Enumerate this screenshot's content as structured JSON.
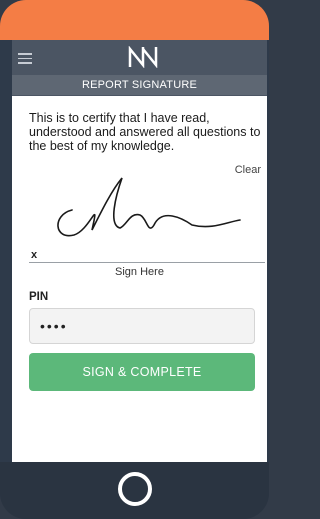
{
  "colors": {
    "top_bezel": "#f47d45",
    "header": "#4b5563",
    "button": "#5cb87a",
    "frame": "#2e3a4a"
  },
  "header": {
    "menu_icon": "hamburger-menu-icon",
    "logo": "N",
    "subtitle": "REPORT SIGNATURE"
  },
  "content": {
    "certification": "This is to certify that I have read, understood and answered all questions to the best of my knowledge.",
    "clear_label": "Clear",
    "x_mark": "x",
    "sign_here": "Sign Here",
    "pin_label": "PIN",
    "pin_value": "••••",
    "submit_label": "SIGN & COMPLETE"
  },
  "device": {
    "home_button": "home-circle-icon"
  }
}
